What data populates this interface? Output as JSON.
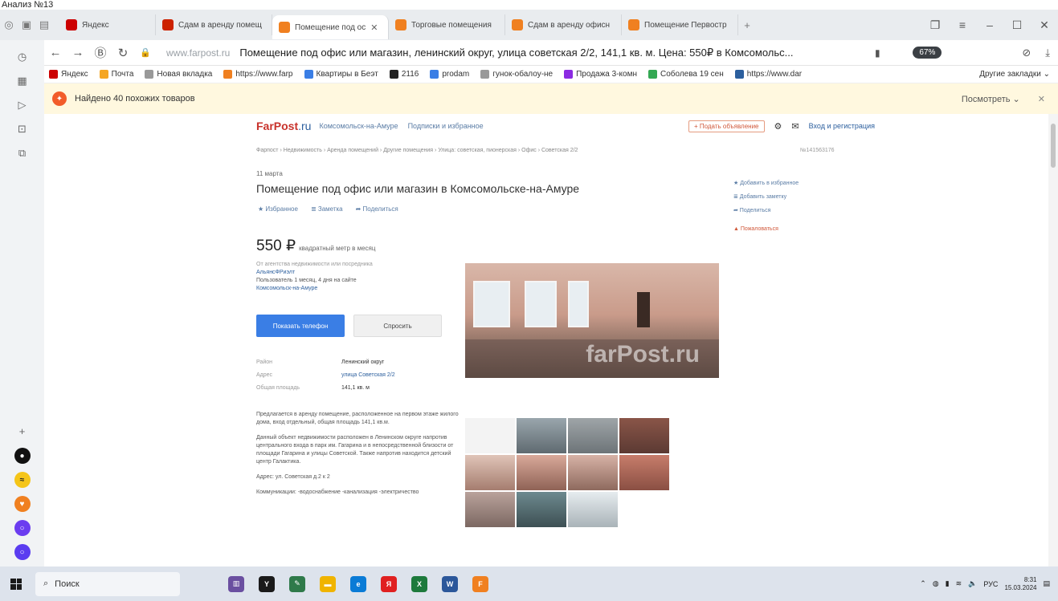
{
  "caption": "Анализ №13",
  "browser": {
    "tabs": [
      {
        "label": "Яндекс",
        "favicon_color": "#cc0000",
        "active": false
      },
      {
        "label": "Сдам в аренду помещ",
        "favicon_color": "#cc2200",
        "active": false
      },
      {
        "label": "Помещение под ос",
        "favicon_color": "#f08020",
        "active": true
      },
      {
        "label": "Торговые помещения",
        "favicon_color": "#f08020",
        "active": false
      },
      {
        "label": "Сдам в аренду офисн",
        "favicon_color": "#f08020",
        "active": false
      },
      {
        "label": "Помещение Первостр",
        "favicon_color": "#f08020",
        "active": false
      }
    ],
    "new_tab_label": "+",
    "url_host": "www.farpost.ru",
    "url_title": "Помещение под офис или магазин, ленинский округ, улица советская 2/2, 141,1 кв. м. Цена: 550₽ в Комсомольс...",
    "speed_badge": "67%",
    "bookmarks": [
      {
        "label": "Яндекс",
        "color": "#cc0000"
      },
      {
        "label": "Почта",
        "color": "#f5a623"
      },
      {
        "label": "Новая вкладка",
        "color": "#999999"
      },
      {
        "label": "https://www.farp",
        "color": "#f08020"
      },
      {
        "label": "Квартиры в Беэт",
        "color": "#3a7ee5"
      },
      {
        "label": "2116",
        "color": "#222222"
      },
      {
        "label": "prodam",
        "color": "#3a7ee5"
      },
      {
        "label": "гунок-обалоу-не",
        "color": "#999999"
      },
      {
        "label": "Продажа 3-комн",
        "color": "#8b2be2"
      },
      {
        "label": "Соболева 19 сен",
        "color": "#34a853"
      },
      {
        "label": "https://www.dar",
        "color": "#2c5f9e"
      }
    ],
    "bookmarks_other": "Другие закладки",
    "suggestion_text": "Найдено 40 похожих товаров",
    "suggestion_view": "Посмотреть"
  },
  "site": {
    "logo_main": "FarPost",
    "logo_tld": ".ru",
    "city_link": "Комсомольск-на-Амуре",
    "subscribe_link": "Подписки и избранное",
    "post_button": "+ Подать объявление",
    "login": "Вход и регистрация"
  },
  "listing": {
    "breadcrumbs": "Фарпост › Недвижимость › Аренда помещений › Другие помещения › Улица: советская, пионерская › Офис › Советская 2/2",
    "ad_id": "№141563176",
    "date": "11 марта",
    "title": "Помещение под офис или магазин в Комсомольске-на-Амуре",
    "actions": [
      "★ Избранное",
      "≣ Заметка",
      "➦ Поделиться"
    ],
    "price": "550 ₽",
    "price_suffix": "квадратный метр в месяц",
    "seller_note": "От агентства недвижимости или посредника",
    "seller_name": "АльянсФРиэлт",
    "seller_since": "Пользователь 1 месяц, 4 дня на сайте",
    "seller_city": "Комсомольск-на-Амуре",
    "phone_button": "Показать телефон",
    "ask_button": "Спросить",
    "params": [
      {
        "k": "Район",
        "v": "Ленинский округ",
        "link": false
      },
      {
        "k": "Адрес",
        "v": "улица Советская 2/2",
        "link": true
      },
      {
        "k": "Общая площадь",
        "v": "141,1 кв. м",
        "link": false
      }
    ],
    "description": [
      "Предлагается в аренду помещение, расположенное на первом этаже жилого дома, вход отдельный, общая площадь 141,1 кв.м.",
      "Данный объект недвижимости расположен в Ленинском округе напротив центрального входа в парк им. Гагарина и в непосредственной близости от площади Гагарина и улицы Советской. Также напротив находится детский центр Галактика.",
      "Адрес: ул. Советская д.2 к 2",
      "Коммуникации: -водоснабжение -канализация -электричество"
    ],
    "photo_watermark": "farPost.ru",
    "side_actions": [
      "★ Добавить в избранное",
      "≣ Добавить заметку",
      "➦ Поделиться"
    ],
    "complain": "▲ Пожаловаться"
  },
  "taskbar": {
    "search_placeholder": "Поиск",
    "lang": "РУС",
    "time": "8:31",
    "date": "15.03.2024"
  }
}
